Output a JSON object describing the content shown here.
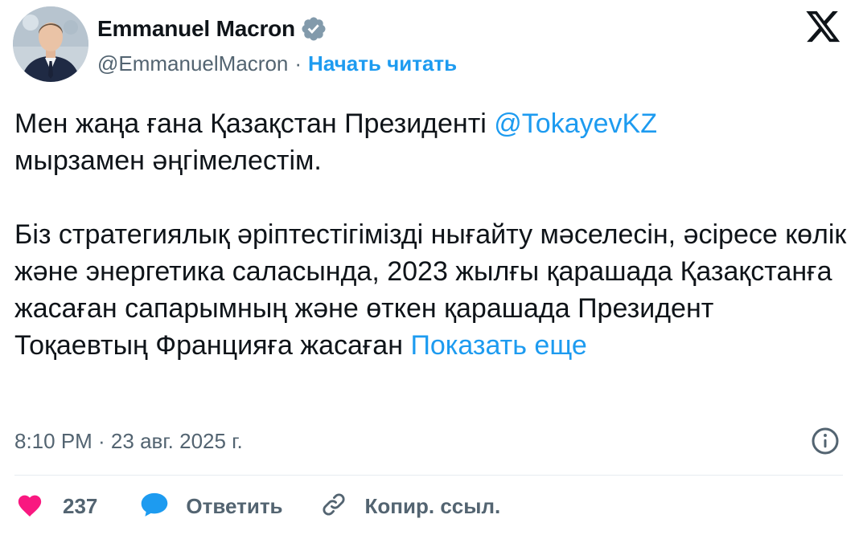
{
  "header": {
    "author_name": "Emmanuel Macron",
    "handle": "@EmmanuelMacron",
    "separator": "·",
    "follow_label": "Начать читать"
  },
  "tweet": {
    "line1_before_mention": "Мен жаңа ғана Қазақстан Президенті ",
    "mention": "@TokayevKZ",
    "line1_after_mention": "мырзамен әңгімелестім.",
    "paragraph2": "Біз стратегиялық әріптестігімізді нығайту мәселесін, әсіресе көлік және энергетика саласында, 2023 жылғы қарашада Қазақстанға жасаған сапарымның және өткен қарашада Президент Тоқаевтың Францияға жасаған ",
    "show_more_label": "Показать еще"
  },
  "meta": {
    "timestamp": "8:10 PM · 23 авг. 2025 г."
  },
  "actions": {
    "like_count": "237",
    "reply_label": "Ответить",
    "copy_link_label": "Копир. ссыл."
  },
  "icons": {
    "verified": "verified-badge-icon",
    "x_logo": "x-logo-icon",
    "info": "info-icon",
    "heart": "heart-icon",
    "reply": "speech-bubble-icon",
    "link": "link-icon"
  },
  "colors": {
    "text": "#0f1419",
    "secondary": "#536471",
    "link": "#1d9bf0",
    "heart": "#f91880",
    "divider": "#e6ecf0"
  }
}
